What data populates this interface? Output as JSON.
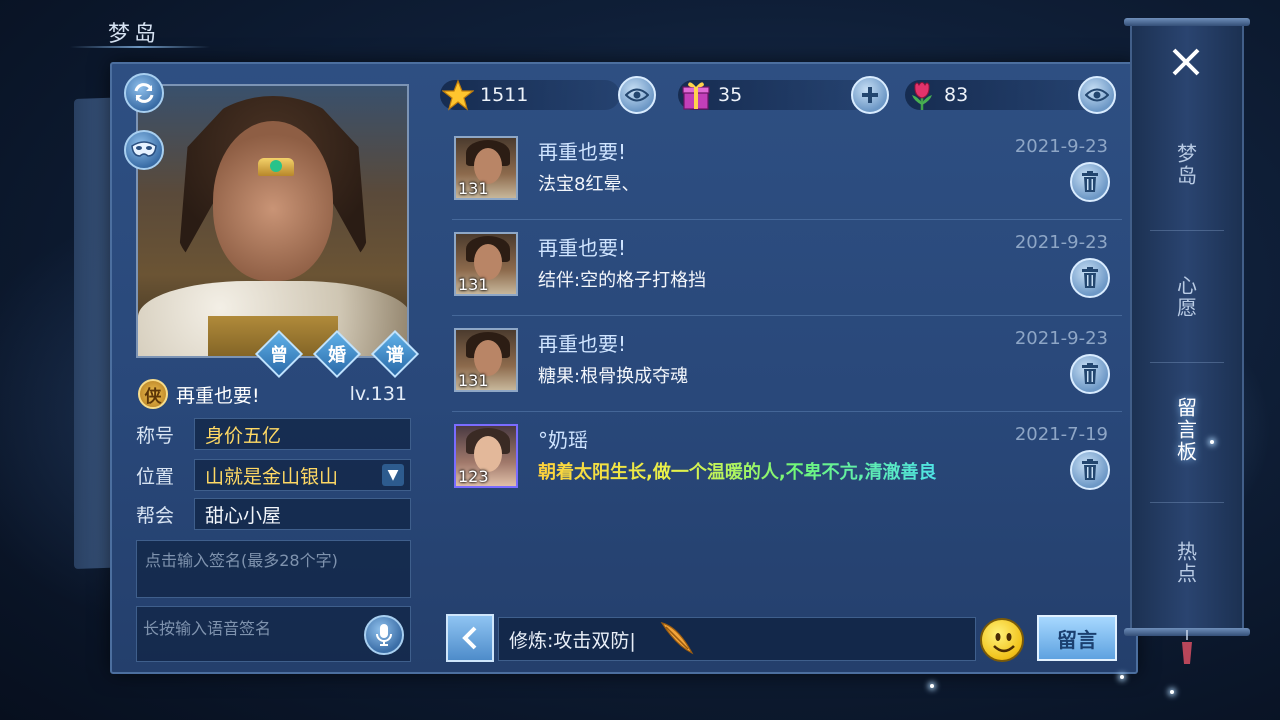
{
  "header": {
    "title": "梦岛"
  },
  "profile": {
    "name": "再重也要!",
    "class_badge": "侠",
    "level": "lv.131",
    "tags": [
      "曾",
      "婚",
      "谱"
    ],
    "fields": [
      {
        "label": "称号",
        "value": "身价五亿"
      },
      {
        "label": "位置",
        "value": "山就是金山银山"
      },
      {
        "label": "帮会",
        "value": "甜心小屋"
      }
    ],
    "signature_placeholder": "点击输入签名(最多28个字)",
    "voice_placeholder": "长按输入语音签名"
  },
  "stats": {
    "stars": "1511",
    "gifts": "35",
    "flowers": "83"
  },
  "messages": [
    {
      "avatar_level": "131",
      "name": "再重也要!",
      "date": "2021-9-23",
      "text": "法宝8红晕、"
    },
    {
      "avatar_level": "131",
      "name": "再重也要!",
      "date": "2021-9-23",
      "text": "结伴:空的格子打格挡"
    },
    {
      "avatar_level": "131",
      "name": "再重也要!",
      "date": "2021-9-23",
      "text": "糖果:根骨换成夺魂"
    },
    {
      "avatar_level": "123",
      "name": "°奶瑶",
      "date": "2021-7-19",
      "text": "朝着太阳生长,做一个温暖的人,不卑不亢,清澈善良"
    }
  ],
  "composer": {
    "value": "修炼:攻击双防|",
    "send_label": "留言"
  },
  "side_tabs": [
    {
      "label": "梦岛"
    },
    {
      "label": "心愿"
    },
    {
      "label": "留言板"
    },
    {
      "label": "热点"
    }
  ],
  "colors": {
    "panel": "#2e4f82",
    "accent_gold": "#ffd964",
    "accent_blue": "#5ea2e0"
  },
  "icons": {
    "refresh": "refresh-icon",
    "mask": "mask-icon",
    "star": "star-icon",
    "gift": "gift-icon",
    "flower": "flower-icon",
    "eye": "eye-icon",
    "plus": "plus-icon",
    "trash": "trash-icon",
    "mic": "microphone-icon",
    "emoji": "smiley-icon",
    "close": "close-icon"
  }
}
